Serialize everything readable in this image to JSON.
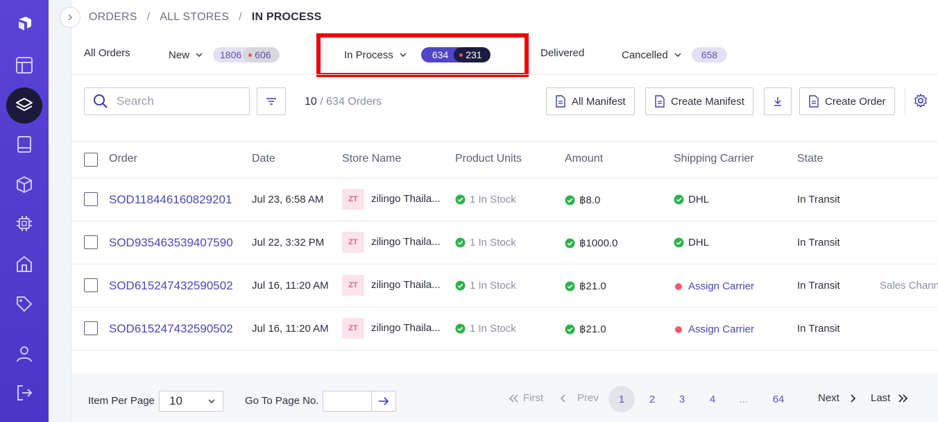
{
  "breadcrumb": {
    "items": [
      "ORDERS",
      "ALL STORES",
      "IN PROCESS"
    ]
  },
  "tabs": {
    "all": {
      "label": "All Orders"
    },
    "new": {
      "label": "New",
      "count_a": "1806",
      "count_b": "606"
    },
    "in_process": {
      "label": "In Process",
      "count_a": "634",
      "count_b": "231"
    },
    "delivered": {
      "label": "Delivered"
    },
    "cancelled": {
      "label": "Cancelled",
      "count": "658"
    }
  },
  "toolbar": {
    "search_placeholder": "Search",
    "count_shown": "10",
    "count_total": "/ 634 Orders",
    "all_manifest": "All Manifest",
    "create_manifest": "Create Manifest",
    "create_order": "Create Order"
  },
  "table": {
    "headers": [
      "Order",
      "Date",
      "Store Name",
      "Product Units",
      "Amount",
      "Shipping Carrier",
      "State"
    ],
    "rows": [
      {
        "order": "SOD118446160829201",
        "date": "Jul 23, 6:58 AM",
        "store_badge": "ZT",
        "store": "zilingo Thaila...",
        "units": "1 In Stock",
        "amount": "฿8.0",
        "carrier": "DHL",
        "carrier_ok": true,
        "state": "In Transit",
        "extra": ""
      },
      {
        "order": "SOD935463539407590",
        "date": "Jul 22, 3:32 PM",
        "store_badge": "ZT",
        "store": "zilingo Thaila...",
        "units": "1 In Stock",
        "amount": "฿1000.0",
        "carrier": "DHL",
        "carrier_ok": true,
        "state": "In Transit",
        "extra": ""
      },
      {
        "order": "SOD615247432590502",
        "date": "Jul 16, 11:20 AM",
        "store_badge": "ZT",
        "store": "zilingo Thaila...",
        "units": "1 In Stock",
        "amount": "฿21.0",
        "carrier": "Assign Carrier",
        "carrier_ok": false,
        "state": "In Transit",
        "extra": "Sales Chann"
      },
      {
        "order": "SOD615247432590502",
        "date": "Jul 16, 11:20 AM",
        "store_badge": "ZT",
        "store": "zilingo Thaila...",
        "units": "1 In Stock",
        "amount": "฿21.0",
        "carrier": "Assign Carrier",
        "carrier_ok": false,
        "state": "In Transit",
        "extra": ""
      }
    ]
  },
  "footer": {
    "item_per_page_label": "Item Per Page",
    "item_per_page_value": "10",
    "goto_label": "Go To Page No.",
    "first": "First",
    "prev": "Prev",
    "pages": [
      "1",
      "2",
      "3",
      "4",
      "...",
      "64"
    ],
    "next": "Next",
    "last": "Last"
  },
  "colors": {
    "sidebar": "#4a36c8",
    "accent": "#4b47b5",
    "highlight": "#ee0000",
    "success": "#2fb24c",
    "danger": "#ee5a66"
  }
}
